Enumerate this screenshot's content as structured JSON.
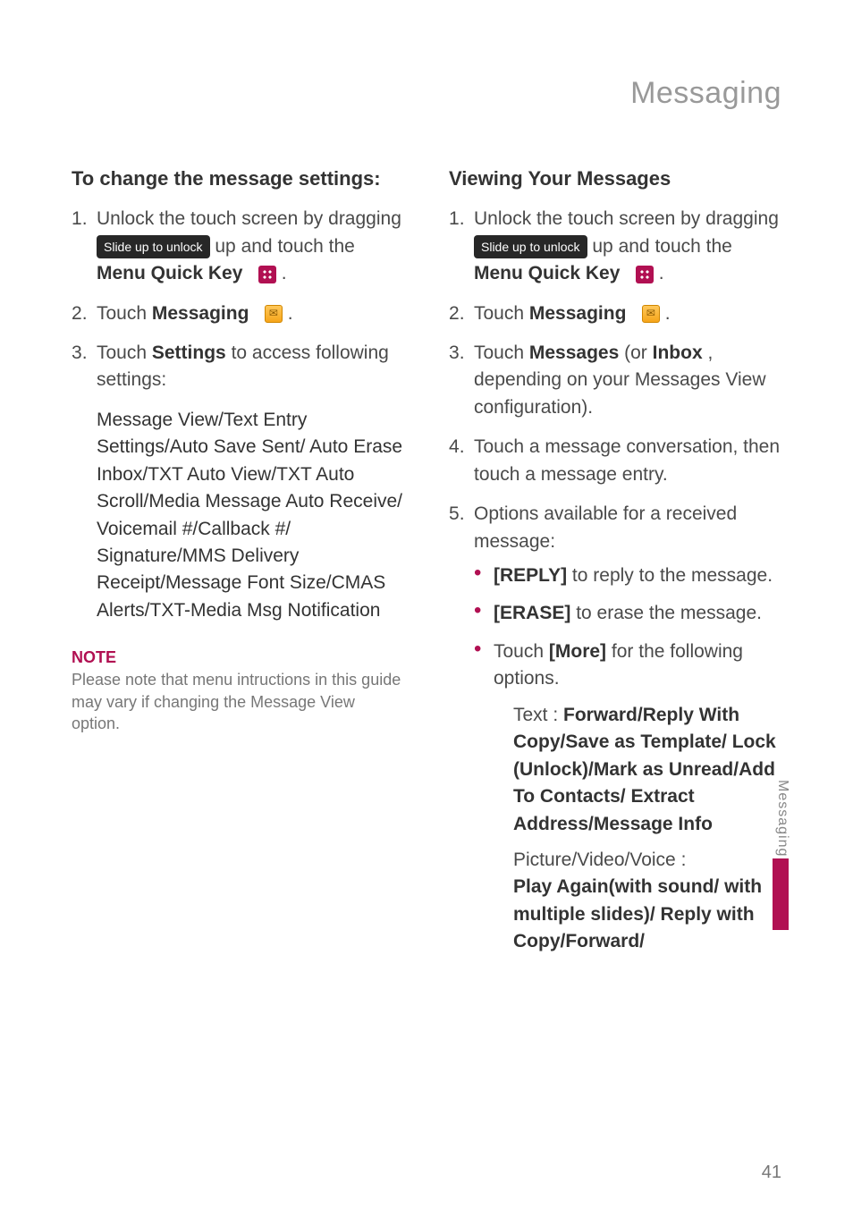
{
  "pageTitle": "Messaging",
  "left": {
    "heading": "To change the message settings:",
    "steps": {
      "s1a": "Unlock the touch screen by dragging ",
      "slidePill": "Slide up to unlock",
      "s1b": " up and touch the ",
      "menuQuick": "Menu Quick Key",
      "s1c": ".",
      "s2a": "Touch ",
      "messaging": "Messaging",
      "s2b": ".",
      "s3a": "Touch ",
      "settingsWord": "Settings",
      "s3b": " to access following settings:"
    },
    "settingsList": "Message View/Text Entry Settings/Auto Save Sent/ Auto Erase Inbox/TXT Auto View/TXT Auto Scroll/Media Message Auto Receive/ Voicemail #/Callback #/ Signature/MMS Delivery Receipt/Message Font Size/CMAS Alerts/TXT-Media Msg Notification",
    "noteLabel": "NOTE",
    "noteText": "Please note that menu intructions in this guide may vary if changing the Message View option."
  },
  "right": {
    "heading": "Viewing Your Messages",
    "s1a": "Unlock the touch screen by dragging ",
    "slidePill": "Slide up to unlock",
    "s1b": " up and touch the ",
    "menuQuick": "Menu Quick Key",
    "s1c": ".",
    "s2a": "Touch ",
    "messaging": "Messaging",
    "s2b": ".",
    "s3a": "Touch ",
    "messagesWord": "Messages",
    "s3mid": " (or ",
    "inboxWord": "Inbox",
    "s3b": ", depending on your Messages View configuration).",
    "s4": "Touch a message conversation, then touch a message entry.",
    "s5": "Options available for a received message:",
    "opt1a": "[REPLY]",
    "opt1b": " to reply to the message.",
    "opt2a": "[ERASE]",
    "opt2b": " to erase the message.",
    "opt3a": "Touch ",
    "opt3more": "[More]",
    "opt3b": " for the following options.",
    "textLabel": "Text : ",
    "textOpts": "Forward/Reply With Copy/Save as Template/ Lock (Unlock)/Mark as Unread/Add To Contacts/ Extract Address/Message Info",
    "pvvLabel": "Picture/Video/Voice : ",
    "pvvOpts": "Play Again(with sound/ with multiple slides)/ Reply with Copy/Forward/"
  },
  "sideTab": "Messaging",
  "pageNumber": "41"
}
